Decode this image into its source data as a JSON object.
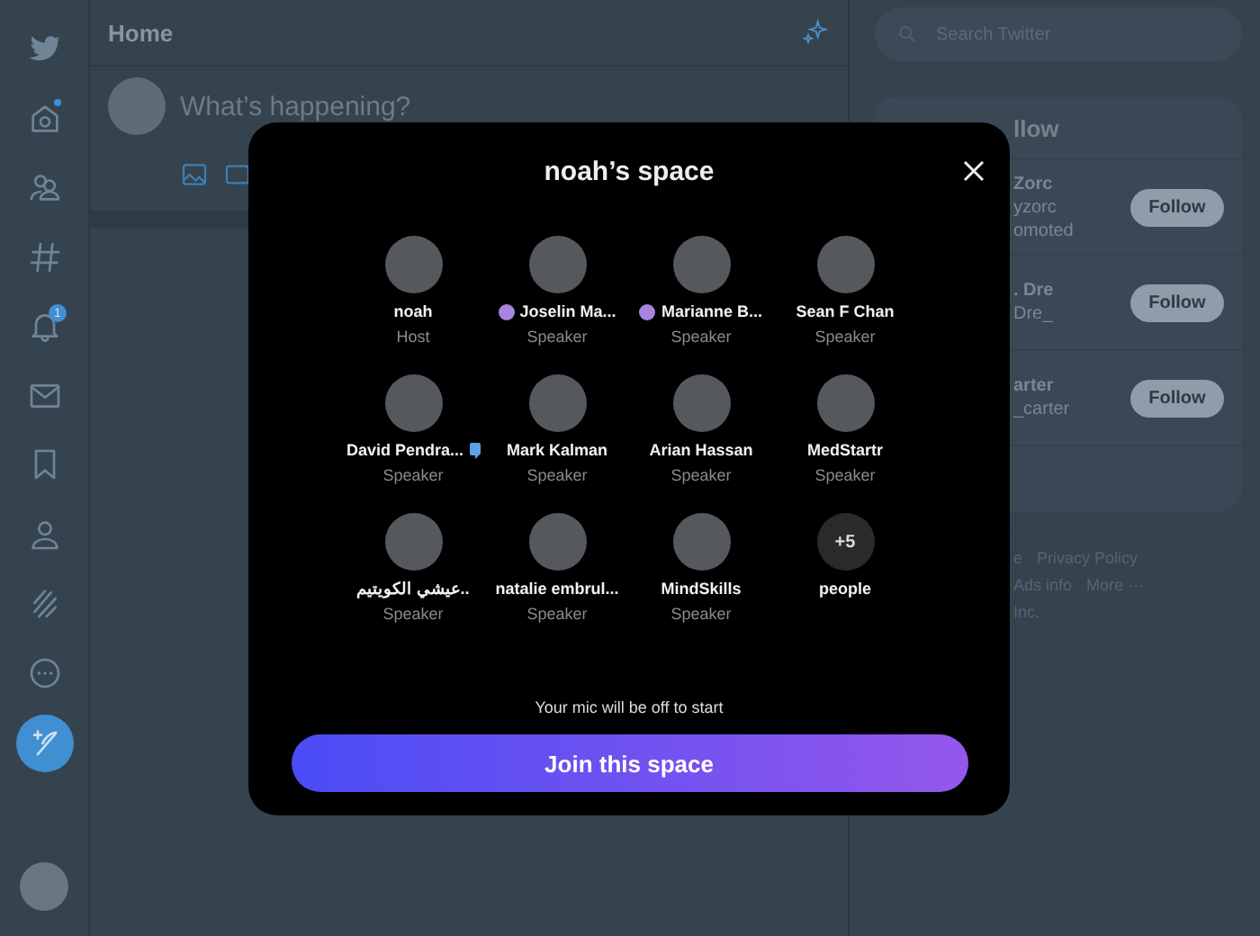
{
  "sidebar": {
    "home_unread": true,
    "notification_count": "1"
  },
  "home": {
    "title": "Home",
    "composer": {
      "placeholder": "What’s happening?"
    }
  },
  "right": {
    "search": {
      "placeholder": "Search Twitter"
    },
    "who_to_follow": {
      "title": "llow",
      "rows": [
        {
          "name": "Zorc",
          "handle": "yzorc",
          "note": "omoted",
          "button": "Follow"
        },
        {
          "name": ". Dre",
          "handle": "Dre_",
          "button": "Follow"
        },
        {
          "name": "arter",
          "handle": "_carter",
          "button": "Follow"
        }
      ]
    },
    "footer_lines": [
      [
        "e",
        "Privacy Policy"
      ],
      [
        "Ads info",
        "More ···"
      ],
      [
        "Inc."
      ]
    ]
  },
  "space": {
    "title": "noah’s space",
    "participants": [
      {
        "kind": "person",
        "name": "noah",
        "role": "Host",
        "dot": false,
        "talking": false
      },
      {
        "kind": "person",
        "name": "Joselin Ma...",
        "role": "Speaker",
        "dot": true,
        "talking": false
      },
      {
        "kind": "person",
        "name": "Marianne B...",
        "role": "Speaker",
        "dot": true,
        "talking": false
      },
      {
        "kind": "person",
        "name": "Sean F Chan",
        "role": "Speaker",
        "dot": false,
        "talking": false
      },
      {
        "kind": "person",
        "name": "David Pendra...",
        "role": "Speaker",
        "dot": false,
        "talking": true
      },
      {
        "kind": "person",
        "name": "Mark Kalman",
        "role": "Speaker",
        "dot": false,
        "talking": false
      },
      {
        "kind": "person",
        "name": "Arian Hassan",
        "role": "Speaker",
        "dot": false,
        "talking": false
      },
      {
        "kind": "person",
        "name": "MedStartr",
        "role": "Speaker",
        "dot": false,
        "talking": false
      },
      {
        "kind": "person",
        "name": "عيشي الكويتيم..",
        "role": "Speaker",
        "dot": false,
        "talking": false
      },
      {
        "kind": "person",
        "name": "natalie embrul...",
        "role": "Speaker",
        "dot": false,
        "talking": false
      },
      {
        "kind": "person",
        "name": "MindSkills",
        "role": "Speaker",
        "dot": false,
        "talking": false
      },
      {
        "kind": "more",
        "count": "+5",
        "name": "people"
      }
    ],
    "mic_note": "Your mic will be off to start",
    "join_button": "Join this space"
  }
}
